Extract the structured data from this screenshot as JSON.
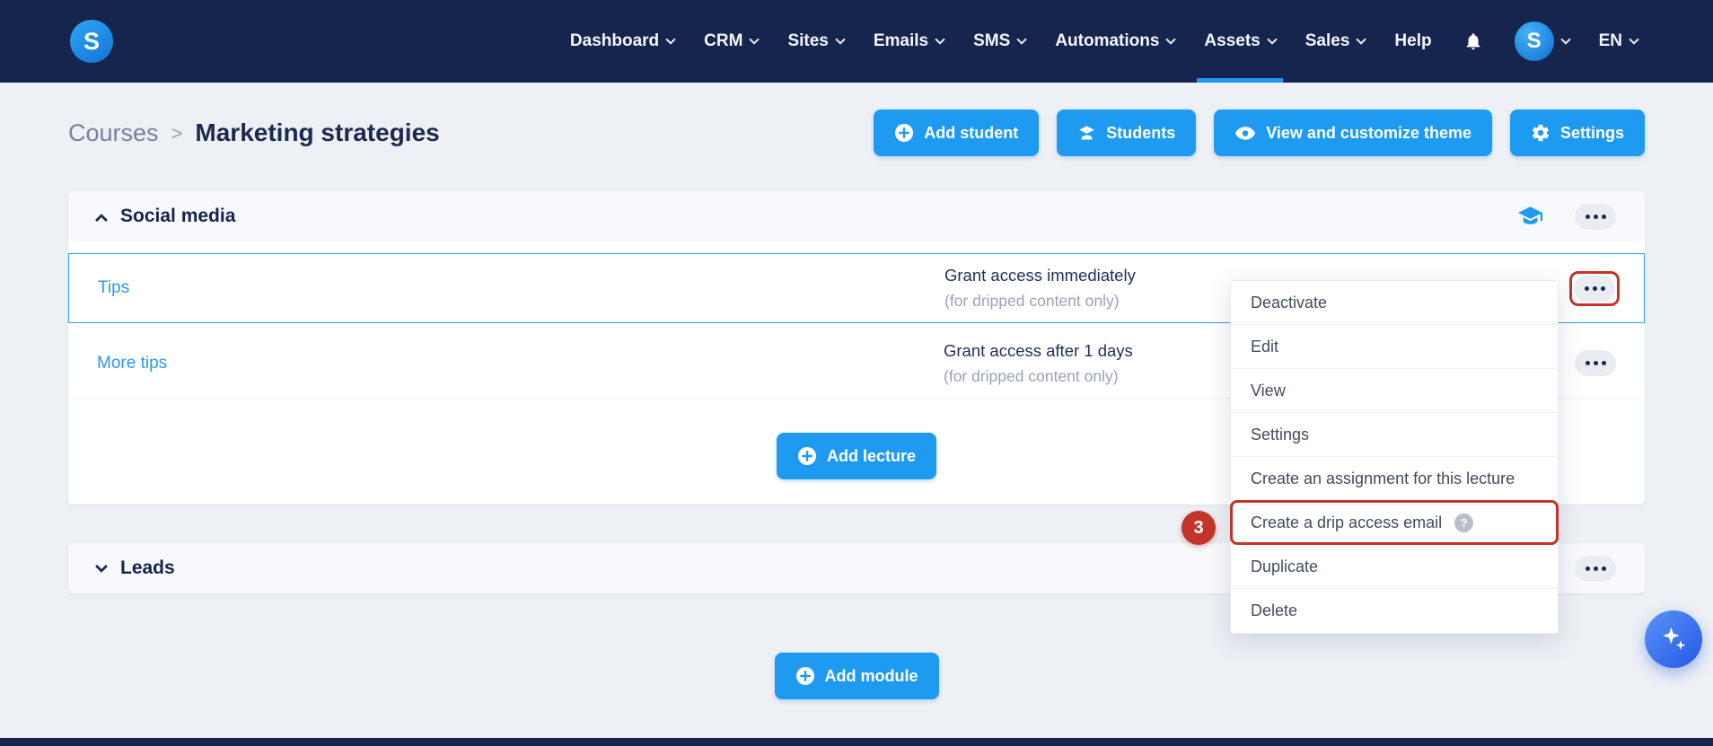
{
  "colors": {
    "navbar_bg": "#16254d",
    "accent_blue": "#1e9bf0",
    "active_underline": "#2196f3",
    "annotation_red": "#c1352b",
    "page_bg": "#edf0f5"
  },
  "nav": {
    "logo": "S",
    "items": [
      {
        "label": "Dashboard",
        "active": false
      },
      {
        "label": "CRM",
        "active": false
      },
      {
        "label": "Sites",
        "active": false
      },
      {
        "label": "Emails",
        "active": false
      },
      {
        "label": "SMS",
        "active": false
      },
      {
        "label": "Automations",
        "active": false
      },
      {
        "label": "Assets",
        "active": true
      },
      {
        "label": "Sales",
        "active": false
      },
      {
        "label": "Help",
        "active": false
      }
    ],
    "avatar": "S",
    "language": "EN"
  },
  "breadcrumb": {
    "parent": "Courses",
    "separator": ">",
    "current": "Marketing strategies"
  },
  "actions": {
    "add_student": "Add student",
    "students": "Students",
    "view_theme": "View and customize theme",
    "settings": "Settings"
  },
  "course": {
    "module1": {
      "title": "Social media",
      "lectures": [
        {
          "title": "Tips",
          "access": "Grant access immediately",
          "note": "(for dripped content only)"
        },
        {
          "title": "More tips",
          "access": "Grant access after 1 days",
          "note": "(for dripped content only)"
        }
      ],
      "add_lecture": "Add lecture"
    },
    "module2": {
      "title": "Leads"
    },
    "add_module": "Add module"
  },
  "menu": {
    "items": [
      {
        "label": "Deactivate"
      },
      {
        "label": "Edit"
      },
      {
        "label": "View"
      },
      {
        "label": "Settings"
      },
      {
        "label": "Create an assignment for this lecture"
      },
      {
        "label": "Create a drip access email",
        "help_icon": "?"
      },
      {
        "label": "Duplicate"
      },
      {
        "label": "Delete"
      }
    ]
  },
  "annotations": {
    "step_badge": "3"
  }
}
